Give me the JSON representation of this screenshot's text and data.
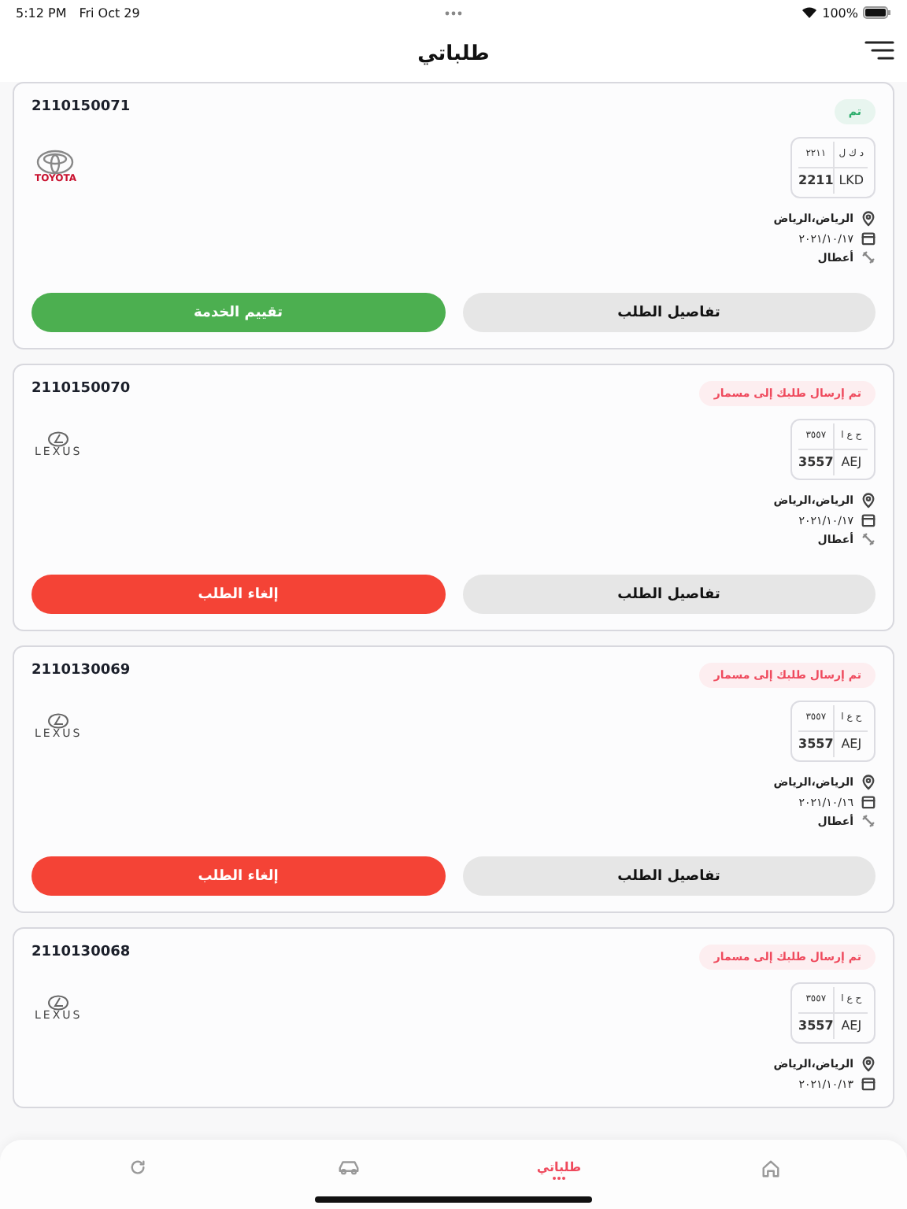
{
  "status_bar": {
    "time": "5:12 PM",
    "date": "Fri Oct 29",
    "battery": "100%"
  },
  "header": {
    "title": "طلباتي"
  },
  "orders": [
    {
      "number": "2110150071",
      "status": {
        "kind": "done",
        "label": "تم"
      },
      "logo": {
        "kind": "toyota",
        "wordmark": "TOYOTA"
      },
      "plate": {
        "letters_ar": "د ك ل",
        "digits_ar": "٢٢١١",
        "letters": "LKD",
        "digits": "2211"
      },
      "city": "الرياض،الرياض",
      "date": "٢٠٢١/١٠/١٧",
      "issue": "أعطال",
      "buttons": [
        {
          "kind": "secondary",
          "label": "تفاصيل الطلب"
        },
        {
          "kind": "rate",
          "label": "تقييم الخدمة"
        }
      ]
    },
    {
      "number": "2110150070",
      "status": {
        "kind": "sent",
        "label": "تم إرسال طلبك إلى مسمار"
      },
      "logo": {
        "kind": "lexus",
        "wordmark": "LEXUS"
      },
      "plate": {
        "letters_ar": "ح ع ا",
        "digits_ar": "٣٥٥٧",
        "letters": "AEJ",
        "digits": "3557"
      },
      "city": "الرياض،الرياض",
      "date": "٢٠٢١/١٠/١٧",
      "issue": "أعطال",
      "buttons": [
        {
          "kind": "secondary",
          "label": "تفاصيل الطلب"
        },
        {
          "kind": "cancel",
          "label": "إلغاء الطلب"
        }
      ]
    },
    {
      "number": "2110130069",
      "status": {
        "kind": "sent",
        "label": "تم إرسال طلبك إلى مسمار"
      },
      "logo": {
        "kind": "lexus",
        "wordmark": "LEXUS"
      },
      "plate": {
        "letters_ar": "ح ع ا",
        "digits_ar": "٣٥٥٧",
        "letters": "AEJ",
        "digits": "3557"
      },
      "city": "الرياض،الرياض",
      "date": "٢٠٢١/١٠/١٦",
      "issue": "أعطال",
      "buttons": [
        {
          "kind": "secondary",
          "label": "تفاصيل الطلب"
        },
        {
          "kind": "cancel",
          "label": "إلغاء الطلب"
        }
      ]
    },
    {
      "number": "2110130068",
      "status": {
        "kind": "sent",
        "label": "تم إرسال طلبك إلى مسمار"
      },
      "logo": {
        "kind": "lexus",
        "wordmark": "LEXUS"
      },
      "plate": {
        "letters_ar": "ح ع ا",
        "digits_ar": "٣٥٥٧",
        "letters": "AEJ",
        "digits": "3557"
      },
      "city": "الرياض،الرياض",
      "date": "٢٠٢١/١٠/١٣"
    }
  ],
  "tab_bar": [
    {
      "kind": "home",
      "selected": false
    },
    {
      "kind": "orders",
      "label": "طلباتي",
      "selected": true
    },
    {
      "kind": "car",
      "selected": false
    },
    {
      "kind": "support",
      "selected": false
    }
  ]
}
